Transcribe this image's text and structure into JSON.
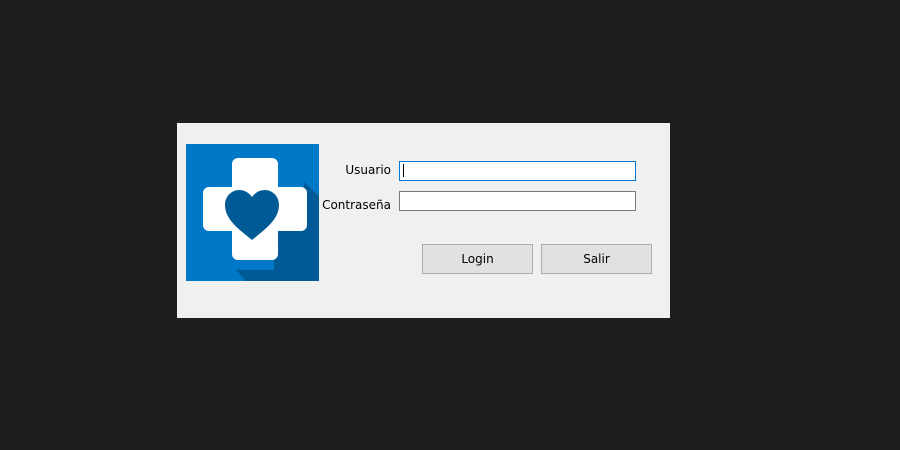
{
  "form": {
    "username_label": "Usuario",
    "username_value": "",
    "password_label": "Contraseña",
    "password_value": "",
    "login_button": "Login",
    "exit_button": "Salir"
  },
  "logo": {
    "icon": "medical-cross-heart-icon",
    "background_color": "#0078c8",
    "shadow_color": "#005a96",
    "cross_color": "#ffffff",
    "heart_color": "#005a96"
  },
  "colors": {
    "desktop_background": "#1e1e1e",
    "dialog_background": "#f0f0f0",
    "focus_border": "#0078d7"
  }
}
